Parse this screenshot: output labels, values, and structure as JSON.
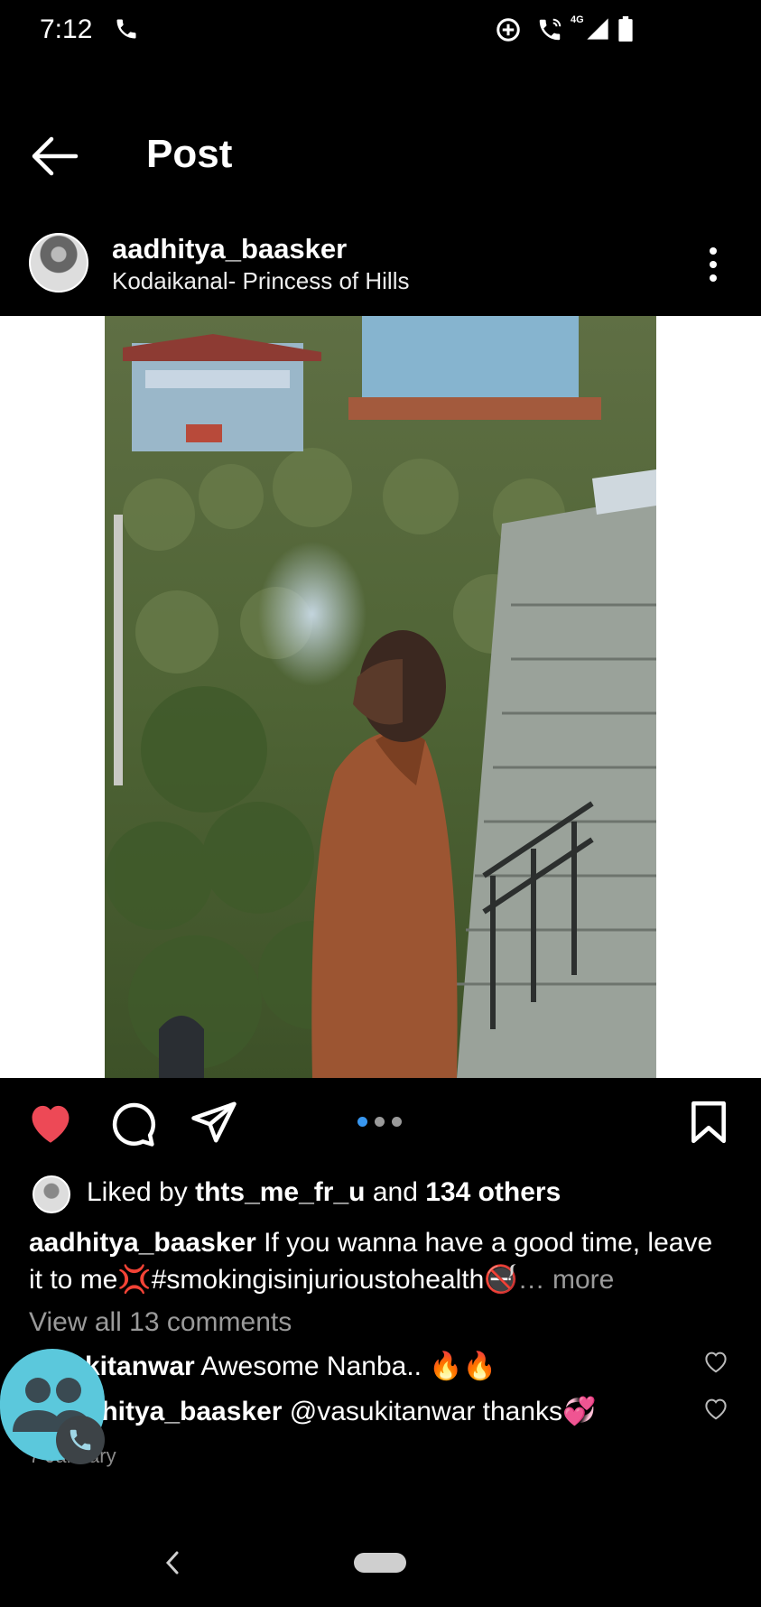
{
  "status_bar": {
    "time": "7:12",
    "network": "4G"
  },
  "header": {
    "title": "Post"
  },
  "post": {
    "username": "aadhitya_baasker",
    "location": "Kodaikanal- Princess of Hills",
    "carousel": {
      "count": 3,
      "active_index": 0,
      "active_color": "#3897f0",
      "inactive_color": "#9a9a9a"
    },
    "liked": true,
    "like_color": "#ed4956"
  },
  "likes": {
    "prefix": "Liked by ",
    "first_user": "thts_me_fr_u",
    "middle": " and ",
    "others": "134 others"
  },
  "caption": {
    "username": "aadhitya_baasker",
    "text": " If you wanna have a good time, leave it to me💢#smokingisinjurioustohealth🚭",
    "more": "… more"
  },
  "comments": {
    "view_all": "View all 13 comments",
    "items": [
      {
        "user": "kitanwar",
        "text": " Awesome Nanba.. 🔥🔥"
      },
      {
        "user": "dhitya_baasker",
        "text": " @vasukitanwar thanks💞"
      }
    ],
    "date": "7 January"
  }
}
